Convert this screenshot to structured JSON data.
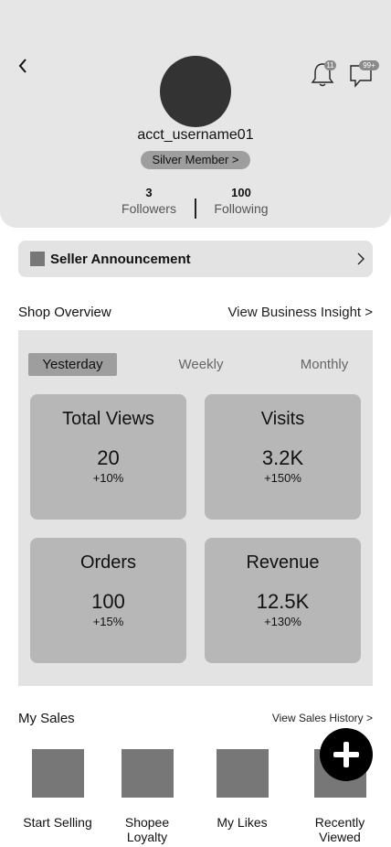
{
  "profile": {
    "username": "acct_username01",
    "member_badge": "Silver Member >",
    "followers_count": "3",
    "followers_label": "Followers",
    "following_count": "100",
    "following_label": "Following"
  },
  "header_icons": {
    "notifications_badge": "11",
    "messages_badge": "99+"
  },
  "announcement": {
    "label": "Seller Announcement"
  },
  "shop_overview": {
    "title": "Shop Overview",
    "link": "View Business Insight >",
    "tabs": [
      {
        "label": "Yesterday",
        "active": true
      },
      {
        "label": "Weekly",
        "active": false
      },
      {
        "label": "Monthly",
        "active": false
      }
    ],
    "cards": [
      {
        "title": "Total Views",
        "value": "20",
        "change": "+10%"
      },
      {
        "title": "Visits",
        "value": "3.2K",
        "change": "+150%"
      },
      {
        "title": "Orders",
        "value": "100",
        "change": "+15%"
      },
      {
        "title": "Revenue",
        "value": "12.5K",
        "change": "+130%"
      }
    ]
  },
  "my_sales": {
    "title": "My Sales",
    "link": "View Sales History >",
    "items": [
      {
        "label": "Start Selling"
      },
      {
        "label": "Shopee Loyalty"
      },
      {
        "label": "My Likes"
      },
      {
        "label": "Recently Viewed"
      }
    ]
  },
  "colors": {
    "header_bg": "#e6e6e6",
    "panel_bg": "#e3e3e3",
    "card_bg": "#b7b7b7",
    "avatar": "#333333",
    "fab": "#000000"
  }
}
